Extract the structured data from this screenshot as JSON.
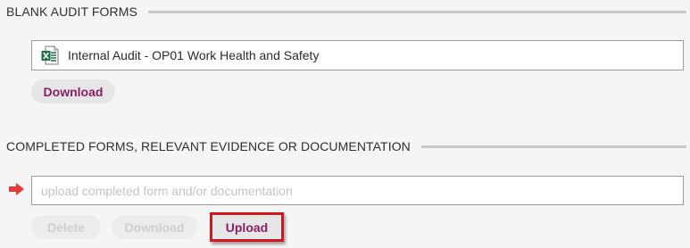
{
  "blank_forms": {
    "heading": "BLANK AUDIT FORMS",
    "file": {
      "name": "Internal Audit - OP01 Work Health and Safety",
      "icon": "excel-file-icon"
    },
    "download_label": "Download"
  },
  "completed_forms": {
    "heading": "COMPLETED FORMS, RELEVANT EVIDENCE OR DOCUMENTATION",
    "input_value": "",
    "input_placeholder": "upload completed form and/or documentation",
    "delete_label": "Delete",
    "download_label": "Download",
    "upload_label": "Upload",
    "arrow_icon": "arrow-right-icon"
  },
  "colors": {
    "accent": "#8b1f63",
    "highlight": "#d9141b",
    "excel_green": "#1e7145",
    "arrow_red": "#e53935"
  }
}
